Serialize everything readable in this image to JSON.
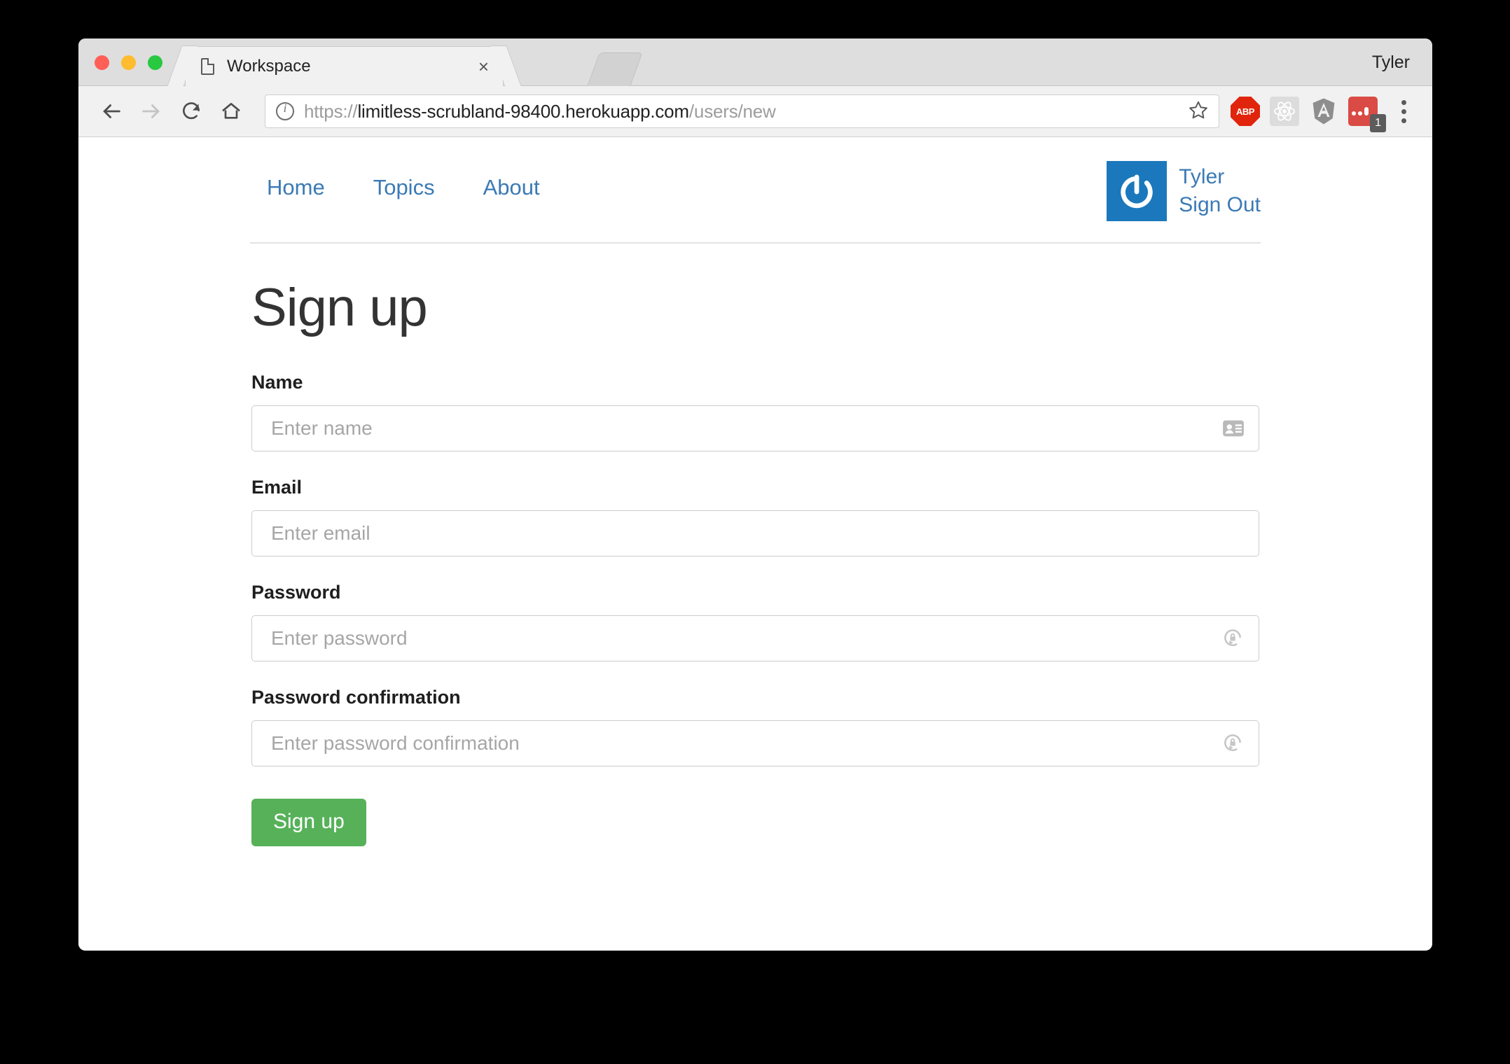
{
  "browser": {
    "profile_name": "Tyler",
    "tab": {
      "title": "Workspace",
      "close_label": "×",
      "favicon": "document-icon"
    },
    "toolbar": {
      "back": "back-arrow-icon",
      "forward": "forward-arrow-icon",
      "reload": "reload-icon",
      "home": "home-icon",
      "url_scheme": "https://",
      "url_host": "limitless-scrubland-98400.herokuapp.com",
      "url_path": "/users/new",
      "bookmark": "star-icon",
      "extensions": [
        {
          "name": "adblock-plus-icon",
          "label": "ABP"
        },
        {
          "name": "react-devtools-icon",
          "label": ""
        },
        {
          "name": "angular-icon",
          "label": "A"
        },
        {
          "name": "pocket-icon",
          "label": "",
          "badge": "1"
        }
      ],
      "menu": "three-dot-menu-icon"
    }
  },
  "site": {
    "nav": [
      {
        "label": "Home"
      },
      {
        "label": "Topics"
      },
      {
        "label": "About"
      }
    ],
    "account": {
      "avatar": "gravatar-power-icon",
      "user_link": "Tyler",
      "signout_link": "Sign Out"
    }
  },
  "main": {
    "title": "Sign up",
    "fields": [
      {
        "label": "Name",
        "placeholder": "Enter name",
        "value": "",
        "type": "text",
        "icon": "contact-card-icon"
      },
      {
        "label": "Email",
        "placeholder": "Enter email",
        "value": "",
        "type": "text",
        "icon": ""
      },
      {
        "label": "Password",
        "placeholder": "Enter password",
        "value": "",
        "type": "password",
        "icon": "lock-circle-icon"
      },
      {
        "label": "Password confirmation",
        "placeholder": "Enter password confirmation",
        "value": "",
        "type": "password",
        "icon": "lock-circle-icon"
      }
    ],
    "submit_label": "Sign up"
  },
  "colors": {
    "link_blue": "#3b7ab5",
    "avatar_blue": "#1b78bc",
    "button_green": "#57b159",
    "heading_gray": "#333333"
  }
}
